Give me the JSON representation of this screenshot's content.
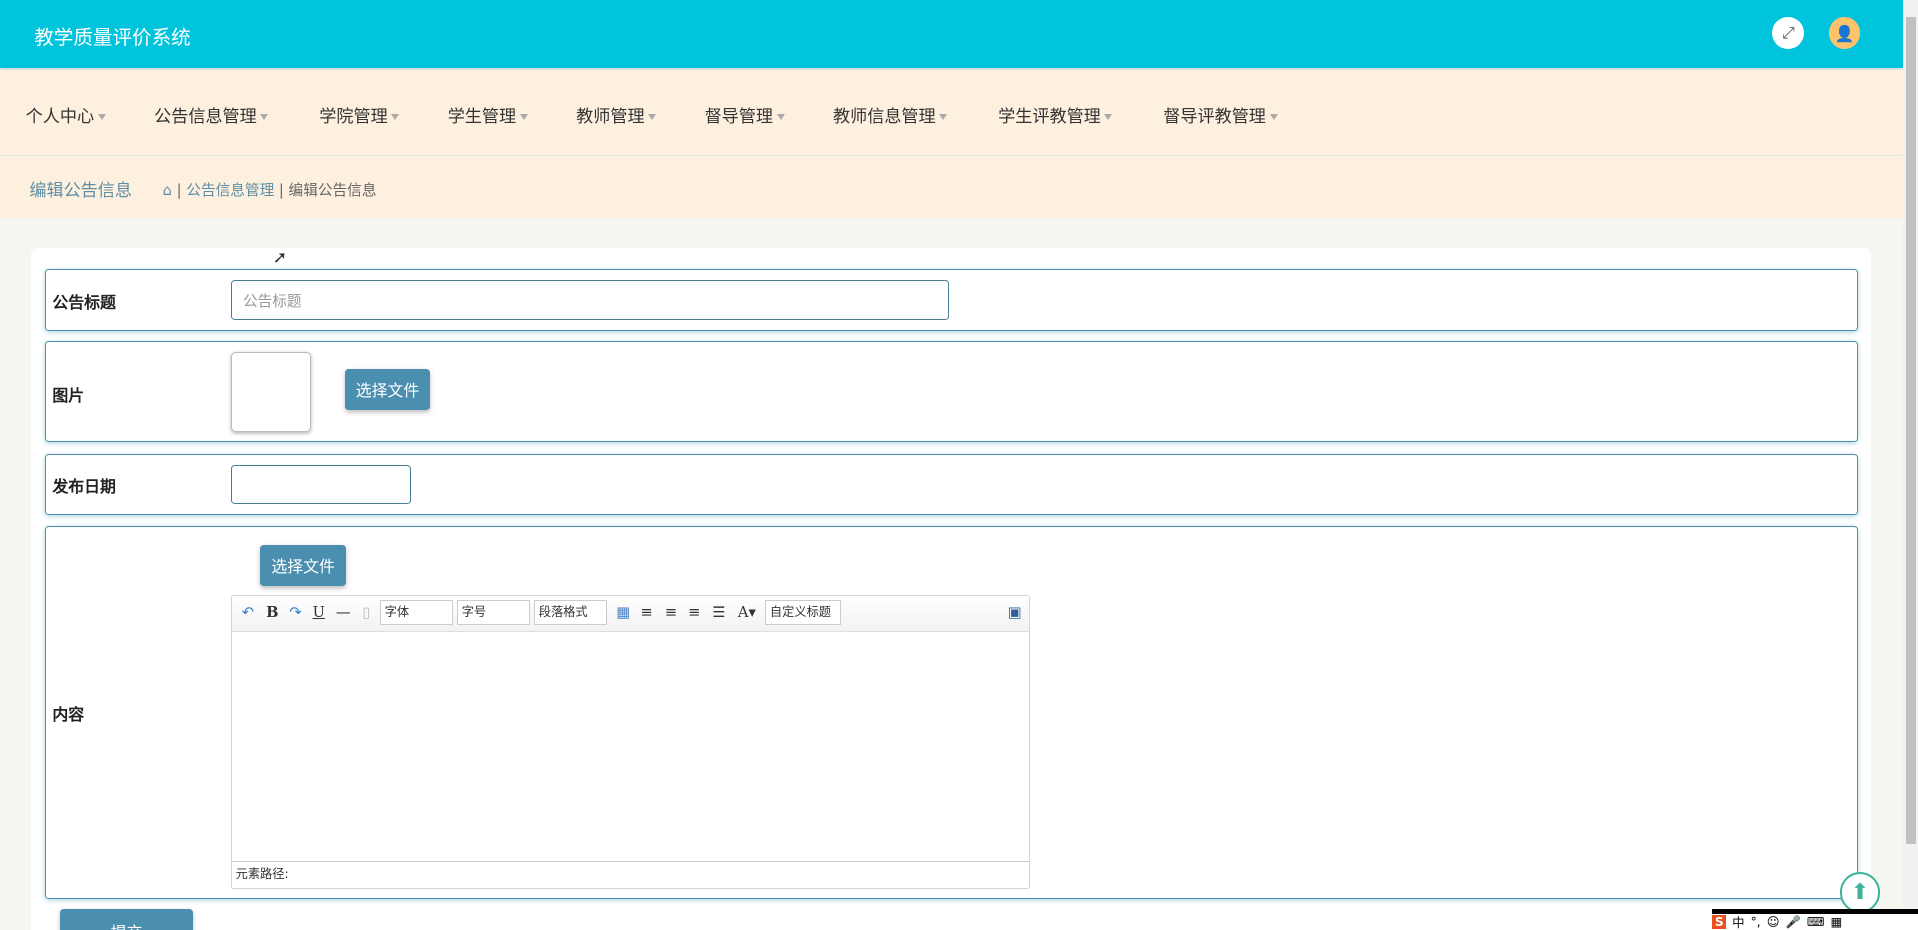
{
  "header": {
    "title": "教学质量评价系统",
    "fullscreen_icon": "fullscreen-icon",
    "avatar_icon": "user-icon"
  },
  "nav": [
    "个人中心",
    "公告信息管理",
    "学院管理",
    "学生管理",
    "教师管理",
    "督导管理",
    "教师信息管理",
    "学生评教管理",
    "督导评教管理"
  ],
  "breadcrumb": {
    "page_title": "编辑公告信息",
    "sep": "|",
    "items": [
      "公告信息管理",
      "编辑公告信息"
    ]
  },
  "form": {
    "title_label": "公告标题",
    "title_placeholder": "公告标题",
    "image_label": "图片",
    "choose_file": "选择文件",
    "date_label": "发布日期",
    "content_label": "内容",
    "editor": {
      "font": "字体",
      "size": "字号",
      "paragraph": "段落格式",
      "custom_title": "自定义标题",
      "path_label": "元素路径:"
    },
    "submit": "提交"
  },
  "ime": {
    "lang": "中"
  },
  "colors": {
    "header": "#00c4dc",
    "nav": "#fdf0df",
    "button": "#4b8fb0"
  }
}
